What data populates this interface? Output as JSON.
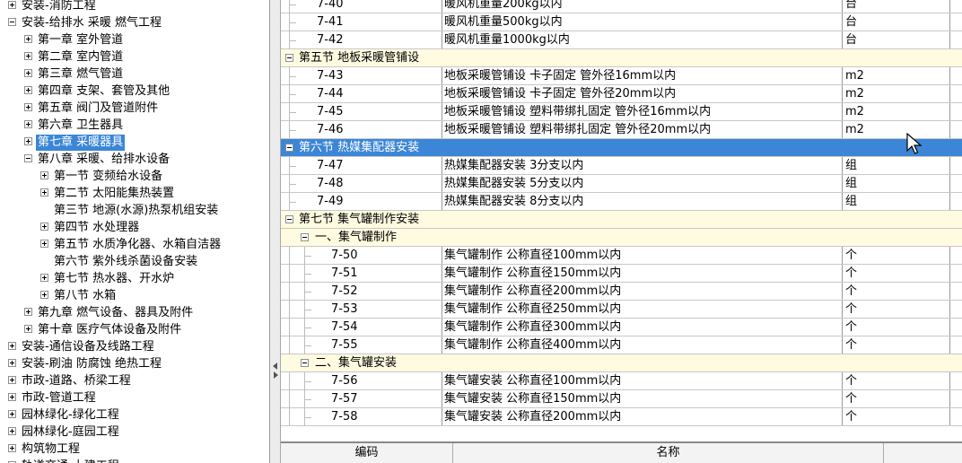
{
  "tree": {
    "items": [
      {
        "label": "安装-消防工程",
        "level": 0,
        "state": "plus"
      },
      {
        "label": "安装-给排水 采暖 燃气工程",
        "level": 0,
        "state": "minus"
      },
      {
        "label": "第一章 室外管道",
        "level": 1,
        "state": "plus"
      },
      {
        "label": "第二章 室内管道",
        "level": 1,
        "state": "plus"
      },
      {
        "label": "第三章 燃气管道",
        "level": 1,
        "state": "plus"
      },
      {
        "label": "第四章 支架、套管及其他",
        "level": 1,
        "state": "plus"
      },
      {
        "label": "第五章 阀门及管道附件",
        "level": 1,
        "state": "plus"
      },
      {
        "label": "第六章 卫生器具",
        "level": 1,
        "state": "plus"
      },
      {
        "label": "第七章 采暖器具",
        "level": 1,
        "state": "plus",
        "selected": true
      },
      {
        "label": "第八章 采暖、给排水设备",
        "level": 1,
        "state": "minus"
      },
      {
        "label": "第一节 变频给水设备",
        "level": 2,
        "state": "plus"
      },
      {
        "label": "第二节 太阳能集热装置",
        "level": 2,
        "state": "plus"
      },
      {
        "label": "第三节 地源(水源)热泵机组安装",
        "level": 2,
        "state": "none"
      },
      {
        "label": "第四节 水处理器",
        "level": 2,
        "state": "plus"
      },
      {
        "label": "第五节 水质净化器、水箱自洁器",
        "level": 2,
        "state": "plus"
      },
      {
        "label": "第六节 紫外线杀菌设备安装",
        "level": 2,
        "state": "none"
      },
      {
        "label": "第七节 热水器、开水炉",
        "level": 2,
        "state": "plus"
      },
      {
        "label": "第八节 水箱",
        "level": 2,
        "state": "plus"
      },
      {
        "label": "第九章 燃气设备、器具及附件",
        "level": 1,
        "state": "plus"
      },
      {
        "label": "第十章 医疗气体设备及附件",
        "level": 1,
        "state": "plus"
      },
      {
        "label": "安装-通信设备及线路工程",
        "level": 0,
        "state": "plus"
      },
      {
        "label": "安装-刷油 防腐蚀 绝热工程",
        "level": 0,
        "state": "plus"
      },
      {
        "label": "市政-道路、桥梁工程",
        "level": 0,
        "state": "plus"
      },
      {
        "label": "市政-管道工程",
        "level": 0,
        "state": "plus"
      },
      {
        "label": "园林绿化-绿化工程",
        "level": 0,
        "state": "plus"
      },
      {
        "label": "园林绿化-庭园工程",
        "level": 0,
        "state": "plus"
      },
      {
        "label": "构筑物工程",
        "level": 0,
        "state": "plus"
      },
      {
        "label": "轨道交通-土建工程",
        "level": 0,
        "state": "plus"
      }
    ]
  },
  "grid": {
    "rows": [
      {
        "type": "item",
        "code": "7-40",
        "name": "暖风机重量200kg以内",
        "unit": "台",
        "depth": 1
      },
      {
        "type": "item",
        "code": "7-41",
        "name": "暖风机重量500kg以内",
        "unit": "台",
        "depth": 1
      },
      {
        "type": "item",
        "code": "7-42",
        "name": "暖风机重量1000kg以内",
        "unit": "台",
        "depth": 1
      },
      {
        "type": "section",
        "label": "第五节 地板采暖管铺设",
        "depth": 0
      },
      {
        "type": "item",
        "code": "7-43",
        "name": "地板采暖管铺设 卡子固定 管外径16mm以内",
        "unit": "m2",
        "depth": 1
      },
      {
        "type": "item",
        "code": "7-44",
        "name": "地板采暖管铺设 卡子固定 管外径20mm以内",
        "unit": "m2",
        "depth": 1
      },
      {
        "type": "item",
        "code": "7-45",
        "name": "地板采暖管铺设 塑料带绑扎固定 管外径16mm以内",
        "unit": "m2",
        "depth": 1
      },
      {
        "type": "item",
        "code": "7-46",
        "name": "地板采暖管铺设 塑料带绑扎固定 管外径20mm以内",
        "unit": "m2",
        "depth": 1
      },
      {
        "type": "section",
        "label": "第六节 热媒集配器安装",
        "depth": 0,
        "selected": true
      },
      {
        "type": "item",
        "code": "7-47",
        "name": "热媒集配器安装 3分支以内",
        "unit": "组",
        "depth": 1
      },
      {
        "type": "item",
        "code": "7-48",
        "name": "热媒集配器安装 5分支以内",
        "unit": "组",
        "depth": 1
      },
      {
        "type": "item",
        "code": "7-49",
        "name": "热媒集配器安装 8分支以内",
        "unit": "组",
        "depth": 1
      },
      {
        "type": "section",
        "label": "第七节 集气罐制作安装",
        "depth": 0
      },
      {
        "type": "section",
        "label": "一、集气罐制作",
        "depth": 1
      },
      {
        "type": "item",
        "code": "7-50",
        "name": "集气罐制作 公称直径100mm以内",
        "unit": "个",
        "depth": 2
      },
      {
        "type": "item",
        "code": "7-51",
        "name": "集气罐制作 公称直径150mm以内",
        "unit": "个",
        "depth": 2
      },
      {
        "type": "item",
        "code": "7-52",
        "name": "集气罐制作 公称直径200mm以内",
        "unit": "个",
        "depth": 2
      },
      {
        "type": "item",
        "code": "7-53",
        "name": "集气罐制作 公称直径250mm以内",
        "unit": "个",
        "depth": 2
      },
      {
        "type": "item",
        "code": "7-54",
        "name": "集气罐制作 公称直径300mm以内",
        "unit": "个",
        "depth": 2
      },
      {
        "type": "item",
        "code": "7-55",
        "name": "集气罐制作 公称直径400mm以内",
        "unit": "个",
        "depth": 2
      },
      {
        "type": "section",
        "label": "二、集气罐安装",
        "depth": 1
      },
      {
        "type": "item",
        "code": "7-56",
        "name": "集气罐安装 公称直径100mm以内",
        "unit": "个",
        "depth": 2
      },
      {
        "type": "item",
        "code": "7-57",
        "name": "集气罐安装 公称直径150mm以内",
        "unit": "个",
        "depth": 2
      },
      {
        "type": "item",
        "code": "7-58",
        "name": "集气罐安装 公称直径200mm以内",
        "unit": "个",
        "depth": 2
      }
    ]
  },
  "bottom_table": {
    "headers": [
      "编码",
      "名称"
    ]
  },
  "colors": {
    "selection": "#3b86d6",
    "section_bg": "#fffbe0"
  }
}
